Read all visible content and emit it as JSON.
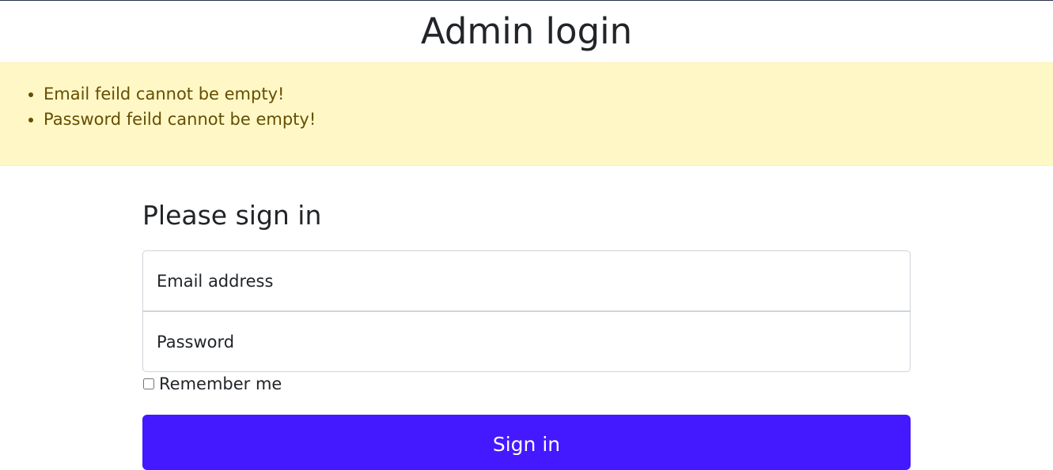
{
  "page": {
    "title": "Admin login"
  },
  "alert": {
    "messages": [
      "Email feild cannot be empty!",
      "Password feild cannot be empty!"
    ],
    "background_color": "#fff8c6",
    "text_color": "#664d03"
  },
  "form": {
    "heading": "Please sign in",
    "email": {
      "placeholder": "Email address",
      "value": ""
    },
    "password": {
      "placeholder": "Password",
      "value": ""
    },
    "remember_label": "Remember me",
    "remember_checked": false,
    "submit_label": "Sign in",
    "submit_color": "#4419ff"
  }
}
